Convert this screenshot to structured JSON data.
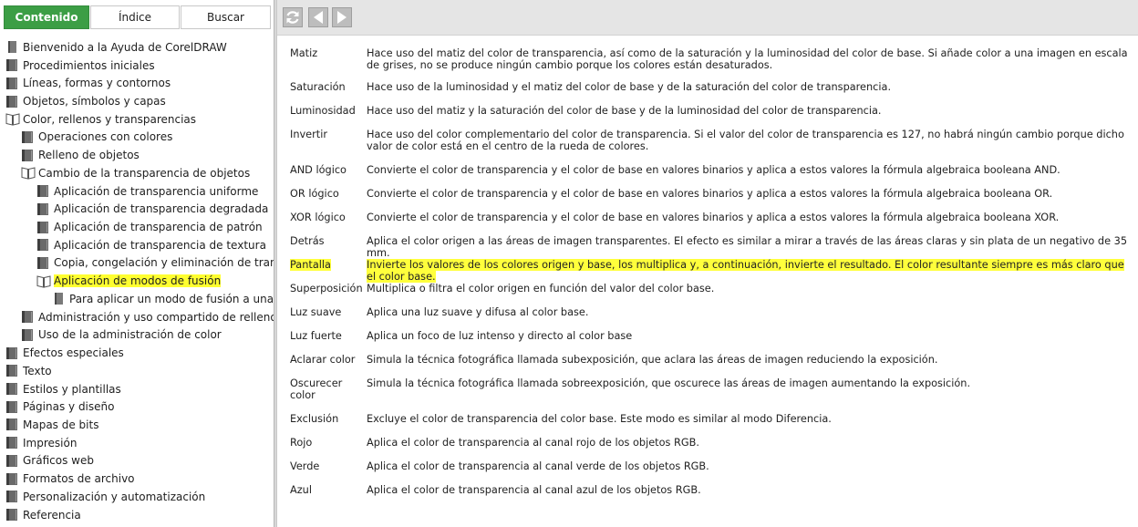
{
  "nav_tabs": [
    {
      "label": "Contenido",
      "active": true
    },
    {
      "label": "Índice",
      "active": false
    },
    {
      "label": "Buscar",
      "active": false
    }
  ],
  "toolbar": {
    "sync_icon": "sync-icon",
    "back_icon": "back-arrow-icon",
    "forward_icon": "forward-arrow-icon"
  },
  "tree": [
    {
      "label": "Bienvenido a la Ayuda de CorelDRAW",
      "level": 0,
      "icon": "page-icon"
    },
    {
      "label": "Procedimientos iniciales",
      "level": 0,
      "icon": "book-closed-icon"
    },
    {
      "label": "Líneas, formas y contornos",
      "level": 0,
      "icon": "book-closed-icon"
    },
    {
      "label": "Objetos, símbolos y capas",
      "level": 0,
      "icon": "book-closed-icon"
    },
    {
      "label": "Color, rellenos y transparencias",
      "level": 0,
      "icon": "book-open-icon"
    },
    {
      "label": "Operaciones con colores",
      "level": 1,
      "icon": "book-closed-icon"
    },
    {
      "label": "Relleno de objetos",
      "level": 1,
      "icon": "book-closed-icon"
    },
    {
      "label": "Cambio de la transparencia de objetos",
      "level": 1,
      "icon": "book-open-icon"
    },
    {
      "label": "Aplicación de transparencia uniforme",
      "level": 2,
      "icon": "book-closed-icon"
    },
    {
      "label": "Aplicación de transparencia degradada",
      "level": 2,
      "icon": "book-closed-icon"
    },
    {
      "label": "Aplicación de transparencia de patrón",
      "level": 2,
      "icon": "book-closed-icon"
    },
    {
      "label": "Aplicación de transparencia de textura",
      "level": 2,
      "icon": "book-closed-icon"
    },
    {
      "label": "Copia, congelación y eliminación de transpar",
      "level": 2,
      "icon": "book-closed-icon"
    },
    {
      "label": "Aplicación de modos de fusión",
      "level": 2,
      "icon": "book-open-icon",
      "highlighted": true
    },
    {
      "label": "Para aplicar un modo de fusión a una tran",
      "level": 3,
      "icon": "page-icon"
    },
    {
      "label": "Administración y uso compartido de rellenos y tr",
      "level": 1,
      "icon": "book-closed-icon"
    },
    {
      "label": "Uso de la administración de color",
      "level": 1,
      "icon": "book-closed-icon"
    },
    {
      "label": "Efectos especiales",
      "level": 0,
      "icon": "book-closed-icon"
    },
    {
      "label": "Texto",
      "level": 0,
      "icon": "book-closed-icon"
    },
    {
      "label": "Estilos y plantillas",
      "level": 0,
      "icon": "book-closed-icon"
    },
    {
      "label": "Páginas y diseño",
      "level": 0,
      "icon": "book-closed-icon"
    },
    {
      "label": "Mapas de bits",
      "level": 0,
      "icon": "book-closed-icon"
    },
    {
      "label": "Impresión",
      "level": 0,
      "icon": "book-closed-icon"
    },
    {
      "label": "Gráficos web",
      "level": 0,
      "icon": "book-closed-icon"
    },
    {
      "label": "Formatos de archivo",
      "level": 0,
      "icon": "book-closed-icon"
    },
    {
      "label": "Personalización y automatización",
      "level": 0,
      "icon": "book-closed-icon"
    },
    {
      "label": "Referencia",
      "level": 0,
      "icon": "book-closed-icon"
    }
  ],
  "modes": [
    {
      "term": "Matiz",
      "desc": "Hace uso del matiz del color de transparencia, así como de la saturación y la luminosidad del color de base. Si añade color a una imagen en escala de grises, no se produce ningún cambio porque los colores están desaturados."
    },
    {
      "term": "Saturación",
      "desc": "Hace uso de la luminosidad y el matiz del color de base y de la saturación del color de transparencia."
    },
    {
      "term": "Luminosidad",
      "desc": "Hace uso del matiz y la saturación del color de base y de la luminosidad del color de transparencia."
    },
    {
      "term": "Invertir",
      "desc": "Hace uso del color complementario del color de transparencia. Si el valor del color de transparencia es 127, no habrá ningún cambio porque dicho valor de color está en el centro de la rueda de colores."
    },
    {
      "term": "AND lógico",
      "desc": "Convierte el color de transparencia y el color de base en valores binarios y aplica a estos valores la fórmula algebraica booleana AND."
    },
    {
      "term": "OR lógico",
      "desc": "Convierte el color de transparencia y el color de base en valores binarios y aplica a estos valores la fórmula algebraica booleana OR."
    },
    {
      "term": "XOR lógico",
      "desc": "Convierte el color de transparencia y el color de base en valores binarios y aplica a estos valores la fórmula algebraica booleana XOR."
    },
    {
      "term": "Detrás",
      "desc": "Aplica el color origen a las áreas de imagen transparentes. El efecto es similar a mirar a través de las áreas claras y sin plata de un negativo de 35 mm."
    },
    {
      "term": "Pantalla",
      "desc": "Invierte los valores de los colores origen y base, los multiplica y, a continuación, invierte el resultado. El color resultante siempre es más claro que el color base.",
      "highlighted": true
    },
    {
      "term": "Superposición",
      "desc": "Multiplica o filtra el color origen en función del valor del color base."
    },
    {
      "term": "Luz suave",
      "desc": "Aplica una luz suave y difusa al color base."
    },
    {
      "term": "Luz fuerte",
      "desc": "Aplica un foco de luz intenso y directo al color base"
    },
    {
      "term": "Aclarar color",
      "desc": "Simula la técnica fotográfica llamada subexposición, que aclara las áreas de imagen reduciendo la exposición."
    },
    {
      "term": "Oscurecer color",
      "desc": "Simula la técnica fotográfica llamada sobreexposición, que oscurece las áreas de imagen aumentando la exposición."
    },
    {
      "term": "Exclusión",
      "desc": "Excluye el color de transparencia del color base. Este modo es similar al modo Diferencia."
    },
    {
      "term": "Rojo",
      "desc": "Aplica el color de transparencia al canal rojo de los objetos RGB."
    },
    {
      "term": "Verde",
      "desc": "Aplica el color de transparencia al canal verde de los objetos RGB."
    },
    {
      "term": "Azul",
      "desc": "Aplica el color de transparencia al canal azul de los objetos RGB."
    }
  ],
  "colors": {
    "active_tab": "#3c9e45",
    "highlight": "#ffff30",
    "toolbar": "#e5e5e5"
  }
}
